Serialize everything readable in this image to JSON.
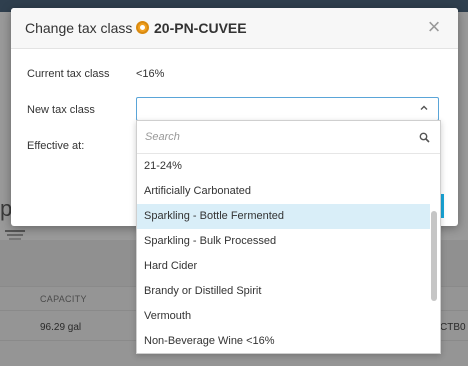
{
  "background": {
    "partial_heading": "p",
    "table_header": "CAPACITY",
    "table_value": "96.29 gal",
    "table_code_partial": "CTB0"
  },
  "modal": {
    "title": "Change tax class",
    "product_code": "20-PN-CUVEE",
    "close_symbol": "×",
    "current_label": "Current tax class",
    "current_value": "<16%",
    "new_label": "New tax class",
    "effective_label": "Effective at:"
  },
  "dropdown": {
    "search_placeholder": "Search",
    "options": [
      "21-24%",
      "Artificially Carbonated",
      "Sparkling - Bottle Fermented",
      "Sparkling - Bulk Processed",
      "Hard Cider",
      "Brandy or Distilled Spirit",
      "Vermouth",
      "Non-Beverage Wine <16%"
    ],
    "highlighted": "Sparkling - Bottle Fermented"
  },
  "colors": {
    "accent": "#1aa7d9",
    "highlight": "#d9eef8",
    "badge": "#f0a020"
  }
}
